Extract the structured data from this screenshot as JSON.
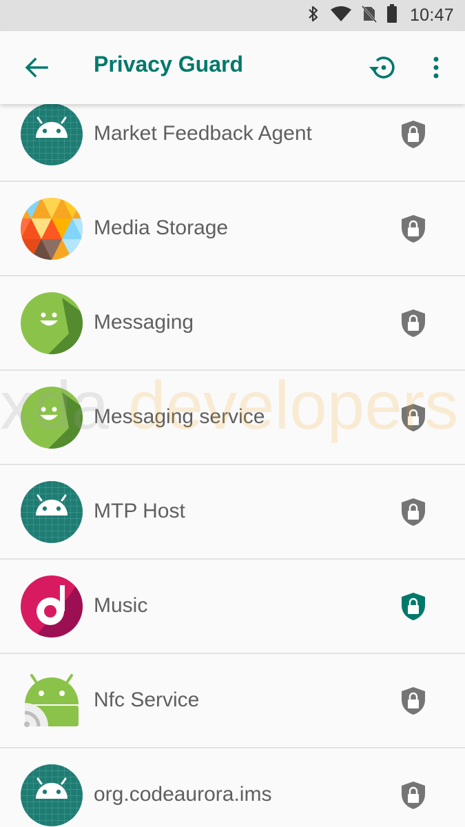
{
  "status_bar": {
    "time": "10:47",
    "icons": [
      "bluetooth-icon",
      "wifi-icon",
      "no-sim-icon",
      "battery-icon"
    ]
  },
  "app_bar": {
    "title": "Privacy Guard",
    "back_icon": "arrow-back-icon",
    "reset_icon": "restore-icon",
    "menu_icon": "more-vert-icon"
  },
  "colors": {
    "accent": "#00796b",
    "shield_off": "#757575",
    "shield_on": "#00796b",
    "label": "#5f5f5f"
  },
  "apps": [
    {
      "label": "Market Feedback Agent",
      "icon": "android-generic-icon",
      "guarded": false
    },
    {
      "label": "Media Storage",
      "icon": "media-storage-icon",
      "guarded": false
    },
    {
      "label": "Messaging",
      "icon": "messaging-icon",
      "guarded": false
    },
    {
      "label": "Messaging service",
      "icon": "messaging-icon",
      "guarded": false
    },
    {
      "label": "MTP Host",
      "icon": "android-generic-icon",
      "guarded": false
    },
    {
      "label": "Music",
      "icon": "music-icon",
      "guarded": true
    },
    {
      "label": "Nfc Service",
      "icon": "nfc-service-icon",
      "guarded": false
    },
    {
      "label": "org.codeaurora.ims",
      "icon": "android-generic-icon",
      "guarded": false
    }
  ],
  "watermark": {
    "prefix": "xda",
    "suffix": "developers"
  }
}
